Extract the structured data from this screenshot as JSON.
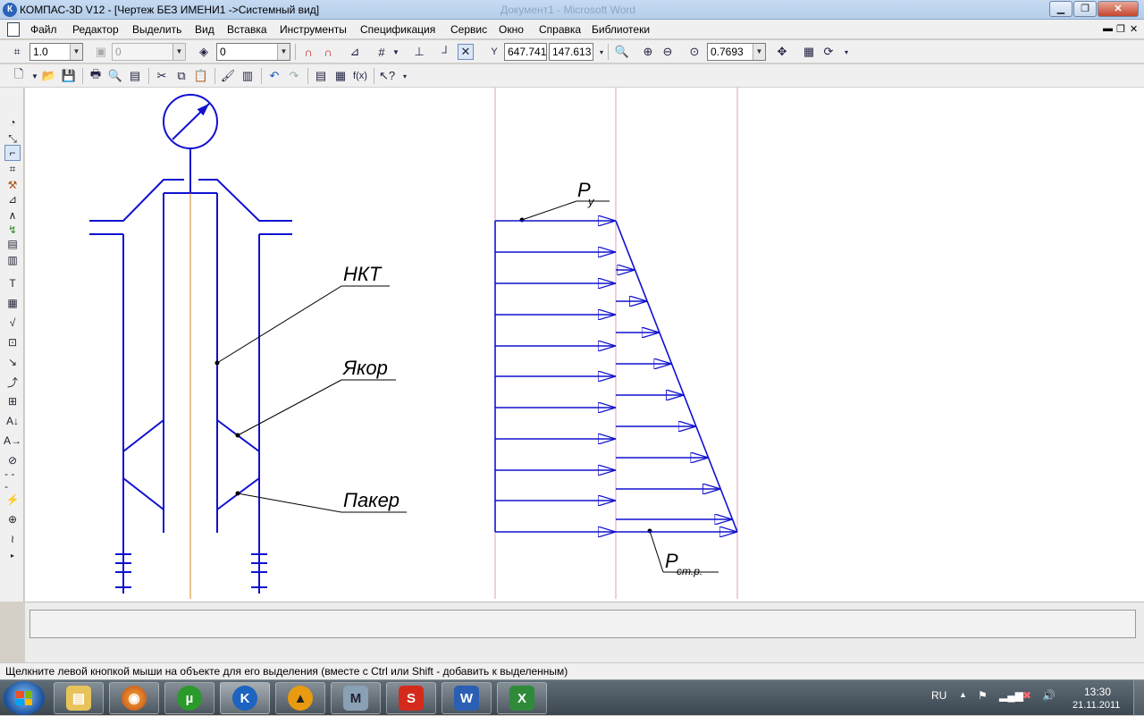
{
  "window": {
    "title": "КОМПАС-3D V12 - [Чертеж БЕЗ ИМЕНИ1 ->Системный вид]",
    "background_title": "Документ1 - Microsoft Word"
  },
  "menu": {
    "items": [
      "Файл",
      "Редактор",
      "Выделить",
      "Вид",
      "Вставка",
      "Инструменты",
      "Спецификация",
      "Сервис",
      "Окно",
      "Справка",
      "Библиотеки"
    ]
  },
  "toolbar": {
    "scale_value": "1.0",
    "layer_value": "0",
    "style_value": "0",
    "coord_x": "647.741",
    "coord_y": "147.613",
    "zoom_value": "0.7693"
  },
  "drawing": {
    "labels": {
      "nkt": "НКТ",
      "yakor": "Якор",
      "paker": "Пакер",
      "p_main": "P",
      "p_y_sub": "у",
      "p_str_sub": "ст.р."
    },
    "line_color": "#1010d0",
    "axis_color": "#d08a1a",
    "guide_color": "#d6a0c0"
  },
  "status": {
    "hint": "Щелкните левой кнопкой мыши на объекте для его выделения (вместе с Ctrl или Shift - добавить к выделенным)"
  },
  "taskbar": {
    "apps": [
      "explorer-icon",
      "firefox-icon",
      "utorrent-icon",
      "kompas-icon",
      "aimp-icon",
      "mathcad-icon",
      "solidworks-icon",
      "word-icon",
      "excel-icon"
    ],
    "language": "RU",
    "time": "13:30",
    "date": "21.11.2011"
  }
}
